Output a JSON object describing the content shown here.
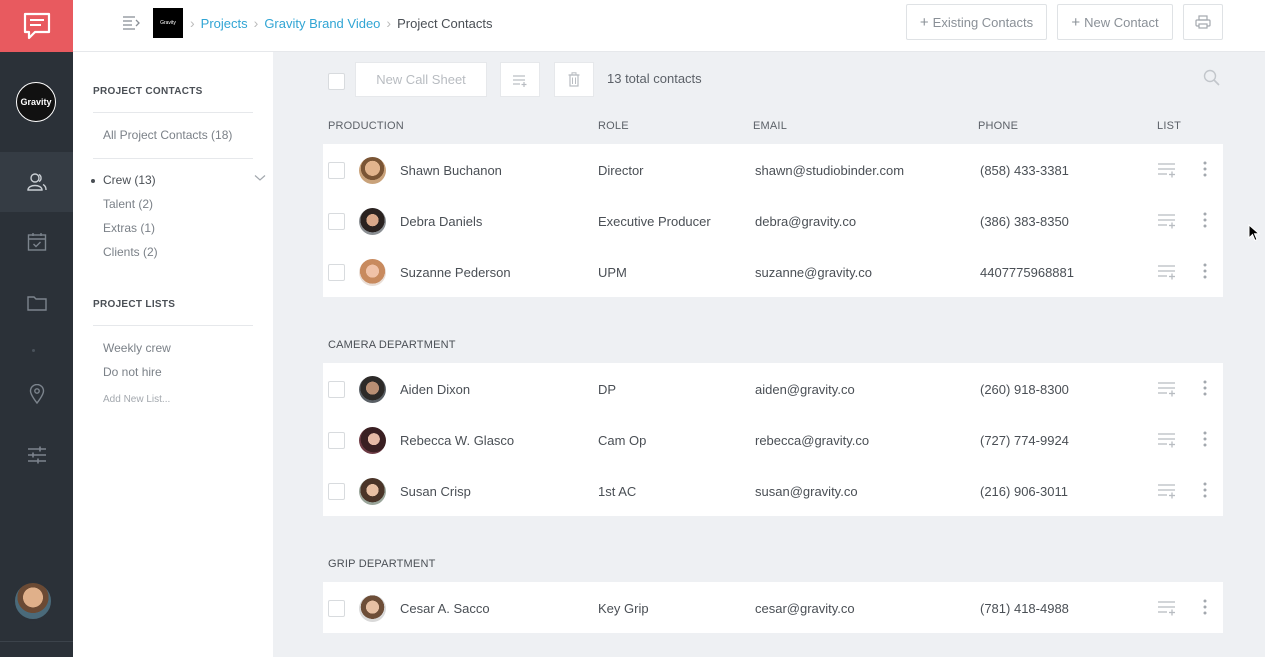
{
  "rail": {
    "org_logo_text": "Gravity",
    "nav": [
      {
        "icon": "contacts-icon",
        "active": true
      },
      {
        "icon": "calendar-icon",
        "active": false
      },
      {
        "icon": "folder-icon",
        "active": false
      },
      {
        "icon": "location-pin-icon",
        "active": false
      },
      {
        "icon": "sliders-icon",
        "active": false
      }
    ]
  },
  "topbar": {
    "project_thumb": "Gravity",
    "breadcrumbs": [
      "Projects",
      "Gravity Brand Video"
    ],
    "current": "Project Contacts",
    "existing_contacts": "Existing Contacts",
    "new_contact": "New Contact"
  },
  "subnav": {
    "contacts_title": "PROJECT CONTACTS",
    "all_contacts": "All Project Contacts (18)",
    "categories": [
      "Crew (13)",
      "Talent (2)",
      "Extras (1)",
      "Clients (2)"
    ],
    "lists_title": "PROJECT LISTS",
    "lists": [
      "Weekly crew",
      "Do not hire"
    ],
    "add_list": "Add New List..."
  },
  "toolbar": {
    "new_call_sheet": "New Call Sheet",
    "total": "13 total contacts"
  },
  "columns": {
    "production": "PRODUCTION",
    "role": "ROLE",
    "email": "EMAIL",
    "phone": "PHONE",
    "list": "LIST"
  },
  "groups": [
    {
      "title": "",
      "rows": [
        {
          "name": "Shawn Buchanon",
          "role": "Director",
          "email": "shawn@studiobinder.com",
          "phone": "(858) 433-3381"
        },
        {
          "name": "Debra Daniels",
          "role": "Executive Producer",
          "email": "debra@gravity.co",
          "phone": "(386) 383-8350"
        },
        {
          "name": "Suzanne Pederson",
          "role": "UPM",
          "email": "suzanne@gravity.co",
          "phone": "4407775968881"
        }
      ]
    },
    {
      "title": "CAMERA DEPARTMENT",
      "rows": [
        {
          "name": "Aiden Dixon",
          "role": "DP",
          "email": "aiden@gravity.co",
          "phone": "(260) 918-8300"
        },
        {
          "name": "Rebecca W. Glasco",
          "role": "Cam Op",
          "email": "rebecca@gravity.co",
          "phone": "(727) 774-9924"
        },
        {
          "name": "Susan Crisp",
          "role": "1st AC",
          "email": "susan@gravity.co",
          "phone": "(216) 906-3011"
        }
      ]
    },
    {
      "title": "GRIP DEPARTMENT",
      "rows": [
        {
          "name": "Cesar A. Sacco",
          "role": "Key Grip",
          "email": "cesar@gravity.co",
          "phone": "(781) 418-4988"
        }
      ]
    }
  ],
  "colors": {
    "brand_red": "#e85a5f",
    "rail_dark": "#2b3138",
    "link_blue": "#31a5d4"
  }
}
